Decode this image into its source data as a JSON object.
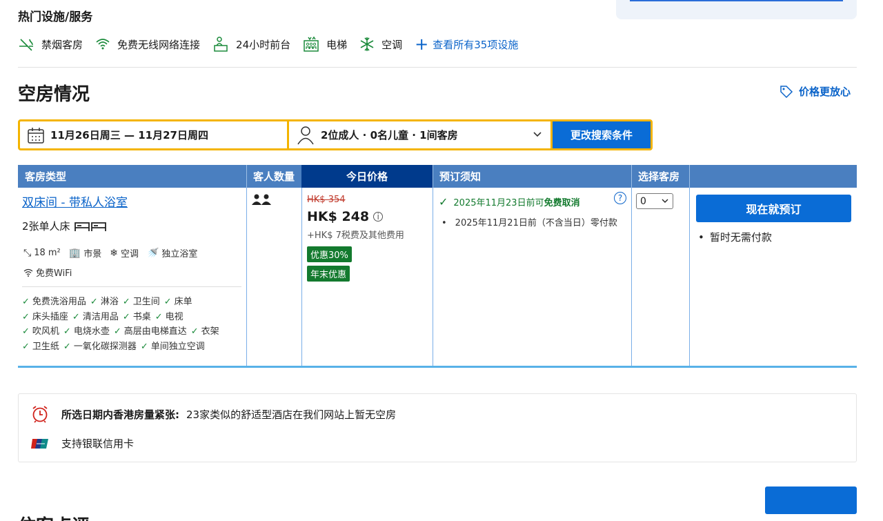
{
  "facilities": {
    "title": "热门设施/服务",
    "items": [
      {
        "label": "禁烟客房",
        "icon": "no-smoking-icon"
      },
      {
        "label": "免费无线网络连接",
        "icon": "wifi-icon"
      },
      {
        "label": "24小时前台",
        "icon": "front-desk-icon"
      },
      {
        "label": "电梯",
        "icon": "elevator-icon"
      },
      {
        "label": "空调",
        "icon": "air-conditioning-icon"
      }
    ],
    "see_all": "查看所有35项设施"
  },
  "availability": {
    "title": "空房情况",
    "price_alert": "价格更放心"
  },
  "search": {
    "dates": "11月26日周三 — 11月27日周四",
    "guests": "2位成人 · 0名儿童 · 1间客房",
    "button": "更改搜索条件"
  },
  "table": {
    "headers": {
      "room_type": "客房类型",
      "guests": "客人数量",
      "price": "今日价格",
      "policy": "预订须知",
      "select": "选择客房"
    },
    "room": {
      "name": "双床间 - 带私人浴室",
      "beds": "2张单人床",
      "size": "18 m²",
      "view": "市景",
      "ac": "空调",
      "bath": "独立浴室",
      "wifi": "免费WiFi",
      "amenities": [
        "免费洗浴用品",
        "淋浴",
        "卫生间",
        "床单",
        "床头插座",
        "清洁用品",
        "书桌",
        "电视",
        "吹风机",
        "电烧水壶",
        "高层由电梯直达",
        "衣架",
        "卫生纸",
        "一氧化碳探测器",
        "单间独立空调"
      ]
    },
    "price": {
      "original": "HK$ 354",
      "current": "HK$ 248",
      "tax": "+HK$ 7税费及其他费用",
      "badges": [
        "优惠30%",
        "年末优惠"
      ]
    },
    "policy": {
      "cancel_prefix": "2025年11月23日前可",
      "cancel_bold": "免费取消",
      "no_prepay": "2025年11月21日前（不含当日）零付款"
    },
    "select_value": "0",
    "book_button": "现在就预订",
    "no_pay_now": "暂时无需付款"
  },
  "notice": {
    "bold": "所选日期内香港房量紧张:",
    "text": "23家类似的舒适型酒店在我们网站上暂无空房",
    "card": "支持银联信用卡"
  },
  "reviews": {
    "title": "住客点评"
  },
  "colors": {
    "primary": "#0a6cd6",
    "header_bg": "#4a7fc0",
    "header_active": "#003a8c",
    "green": "#137a2e",
    "highlight": "#f4b400"
  }
}
